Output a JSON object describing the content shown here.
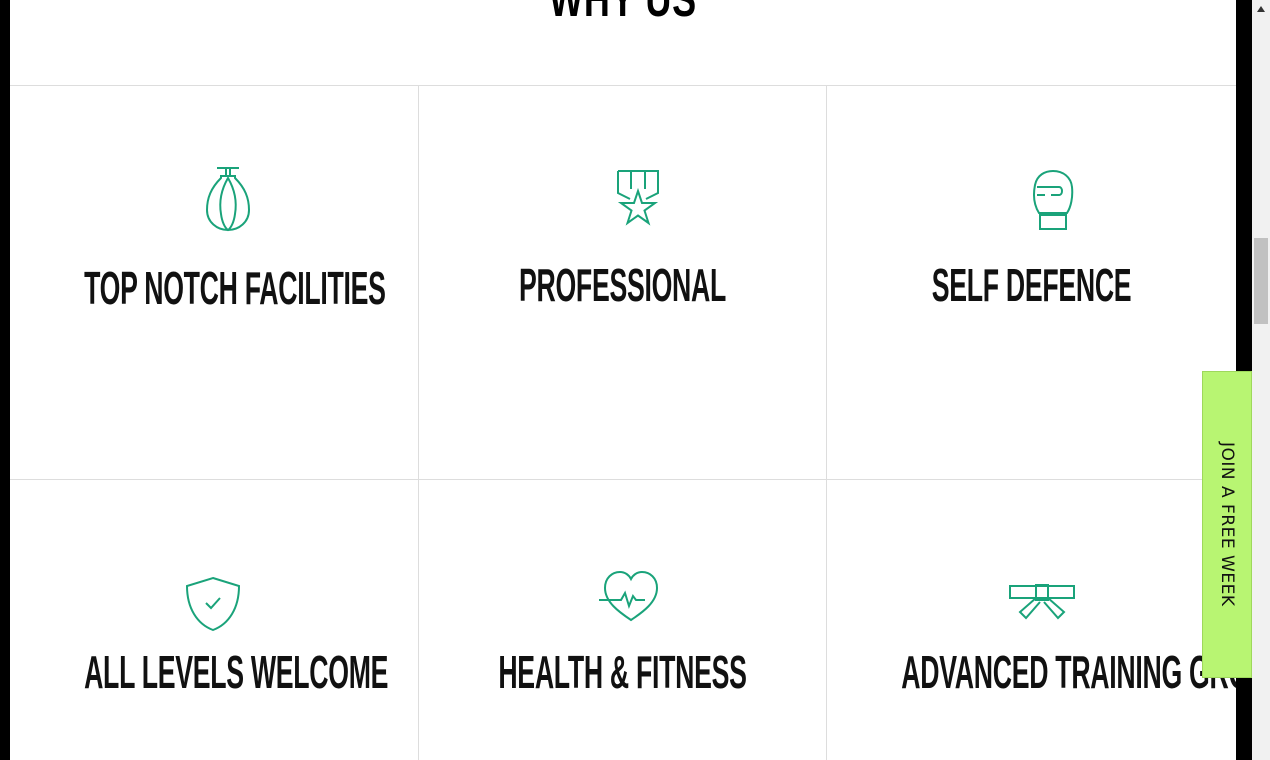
{
  "section": {
    "title": "WHY US"
  },
  "features": [
    {
      "label": "TOP NOTCH FACILITIES",
      "icon": "punching-bag-icon"
    },
    {
      "label": "PROFESSIONAL",
      "icon": "medal-star-icon"
    },
    {
      "label": "SELF DEFENCE",
      "icon": "boxing-glove-icon"
    },
    {
      "label": "ALL LEVELS WELCOME",
      "icon": "shield-check-icon"
    },
    {
      "label": "HEALTH & FITNESS",
      "icon": "heart-pulse-icon"
    },
    {
      "label": "ADVANCED TRAINING GROUPS",
      "icon": "belt-icon"
    }
  ],
  "cta": {
    "label": "JOIN A FREE WEEK"
  },
  "colors": {
    "accent": "#1aa37a",
    "cta_bg": "#b8f572",
    "divider": "#dddddd"
  }
}
